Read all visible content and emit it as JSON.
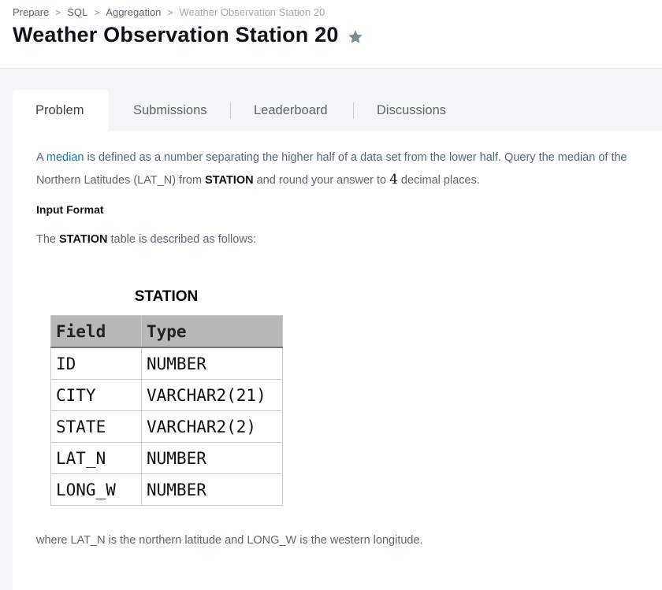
{
  "breadcrumb": {
    "items": [
      "Prepare",
      "SQL",
      "Aggregation"
    ],
    "current": "Weather Observation Station 20"
  },
  "page": {
    "title": "Weather Observation Station 20"
  },
  "icons": {
    "star": "star-icon",
    "separator": "chevron-right-icon"
  },
  "tabs": [
    {
      "label": "Problem",
      "active": true
    },
    {
      "label": "Submissions"
    },
    {
      "label": "Leaderboard"
    },
    {
      "label": "Discussions"
    }
  ],
  "problem": {
    "p1_a": "A ",
    "p1_link": "median",
    "p1_b": " is defined as a number separating the higher half of a data set from the lower half. Query the median of the",
    "p1_c": "Northern Latitudes (LAT_N) from ",
    "p1_bold": "STATION",
    "p1_d": " and round your answer to ",
    "p1_num": "4",
    "p1_e": " decimal places.",
    "input_heading": "Input Format",
    "p2_a": "The ",
    "p2_bold": "STATION",
    "p2_b": " table is described as follows:",
    "footer": "where LAT_N is the northern latitude and LONG_W is the western longitude."
  },
  "station_table": {
    "caption": "STATION",
    "headers": [
      "Field",
      "Type"
    ],
    "rows": [
      [
        "ID",
        "NUMBER"
      ],
      [
        "CITY",
        "VARCHAR2(21)"
      ],
      [
        "STATE",
        "VARCHAR2(2)"
      ],
      [
        "LAT_N",
        "NUMBER"
      ],
      [
        "LONG_W",
        "NUMBER"
      ]
    ]
  },
  "colors": {
    "link": "#1a73b9",
    "title": "#0e141e",
    "star": "#738f93",
    "page_bg": "#f3f5f6"
  }
}
